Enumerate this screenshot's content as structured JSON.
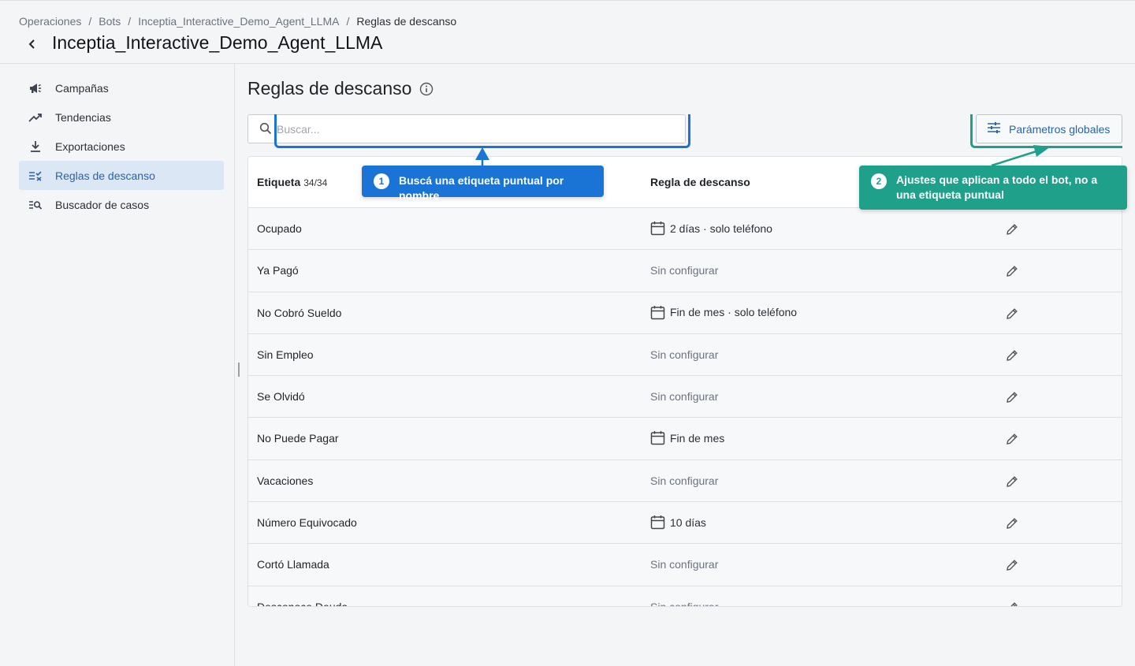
{
  "breadcrumb": {
    "items": [
      "Operaciones",
      "Bots",
      "Inceptia_Interactive_Demo_Agent_LLMA"
    ],
    "current": "Reglas de descanso",
    "separator": "/"
  },
  "header": {
    "title": "Inceptia_Interactive_Demo_Agent_LLMA"
  },
  "sidebar": {
    "items": [
      {
        "label": "Campañas",
        "icon": "megaphone-icon"
      },
      {
        "label": "Tendencias",
        "icon": "trending-up-icon"
      },
      {
        "label": "Exportaciones",
        "icon": "download-icon"
      },
      {
        "label": "Reglas de descanso",
        "icon": "rules-icon",
        "active": true
      },
      {
        "label": "Buscador de casos",
        "icon": "search-list-icon"
      }
    ]
  },
  "main": {
    "title": "Reglas de descanso",
    "search": {
      "placeholder": "Buscar..."
    },
    "global_button": "Parámetros globales",
    "table": {
      "col_label": "Etiqueta",
      "count": "34/34",
      "col_rule": "Regla de descanso",
      "rows": [
        {
          "label": "Ocupado",
          "rule": "2 días · solo teléfono",
          "has_rule": true
        },
        {
          "label": "Ya Pagó",
          "rule": "Sin configurar",
          "has_rule": false
        },
        {
          "label": "No Cobró Sueldo",
          "rule": "Fin de mes · solo teléfono",
          "has_rule": true
        },
        {
          "label": "Sin Empleo",
          "rule": "Sin configurar",
          "has_rule": false
        },
        {
          "label": "Se Olvidó",
          "rule": "Sin configurar",
          "has_rule": false
        },
        {
          "label": "No Puede Pagar",
          "rule": "Fin de mes",
          "has_rule": true
        },
        {
          "label": "Vacaciones",
          "rule": "Sin configurar",
          "has_rule": false
        },
        {
          "label": "Número Equivocado",
          "rule": "10 días",
          "has_rule": true
        },
        {
          "label": "Cortó Llamada",
          "rule": "Sin configurar",
          "has_rule": false
        },
        {
          "label": "Desconoce Deuda",
          "rule": "Sin configurar",
          "has_rule": false
        }
      ]
    }
  },
  "callouts": {
    "one": {
      "num": "1",
      "text": "Buscá una etiqueta puntual por nombre"
    },
    "two": {
      "num": "2",
      "text": "Ajustes que aplican a todo el bot, no a una etiqueta puntual"
    }
  },
  "colors": {
    "accent_blue": "#1a74d6",
    "accent_teal": "#1fa08b",
    "active_bg": "#dbe7f5"
  }
}
